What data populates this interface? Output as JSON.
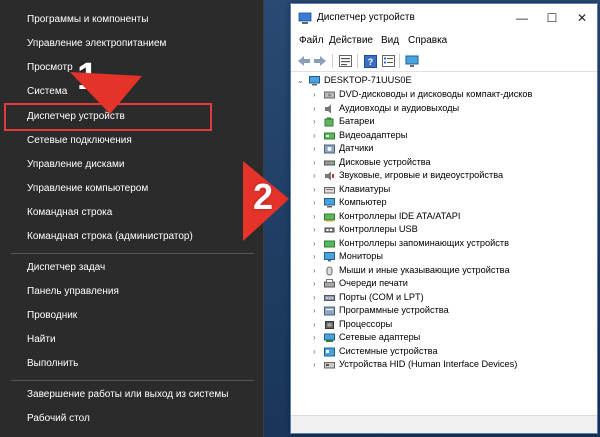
{
  "context_menu": {
    "items": [
      {
        "label": "Программы и компоненты",
        "underline": ""
      },
      {
        "label": "Управление электропитанием",
        "underline": ""
      },
      {
        "label": "Просмотр",
        "underline": ""
      },
      {
        "label": "Система",
        "underline": ""
      },
      {
        "label": "Диспетчер устройств",
        "underline": ""
      },
      {
        "label": "Сетевые подключения",
        "underline": ""
      },
      {
        "label": "Управление дисками",
        "underline": ""
      },
      {
        "label": "Управление компьютером",
        "underline": ""
      },
      {
        "label": "Командная строка",
        "underline": ""
      },
      {
        "label": "Командная строка (администратор)",
        "underline": ""
      },
      {
        "label": "Диспетчер задач",
        "underline": ""
      },
      {
        "label": "Панель управления",
        "underline": ""
      },
      {
        "label": "Проводник",
        "underline": ""
      },
      {
        "label": "Найти",
        "underline": ""
      },
      {
        "label": "Выполнить",
        "underline": ""
      },
      {
        "label": "Завершение работы или выход из системы",
        "underline": ""
      },
      {
        "label": "Рабочий стол",
        "underline": ""
      }
    ],
    "highlighted_item": "Диспетчер устройств"
  },
  "annotations": {
    "step1": "1",
    "step2": "2",
    "arrow_color": "#e5332a"
  },
  "window": {
    "title": "Диспетчер устройств",
    "controls": {
      "minimize": "—",
      "maximize": "☐",
      "close": "✕"
    },
    "menu": [
      "Файл",
      "Действие",
      "Вид",
      "Справка"
    ],
    "root": "DESKTOP-71UUS0E",
    "devices": [
      {
        "label": "DVD-дисководы и дисководы компакт-дисков",
        "icon": "dvd-drive-icon"
      },
      {
        "label": "Аудиовходы и аудиовыходы",
        "icon": "speaker-icon"
      },
      {
        "label": "Батареи",
        "icon": "battery-icon"
      },
      {
        "label": "Видеоадаптеры",
        "icon": "display-adapter-icon"
      },
      {
        "label": "Датчики",
        "icon": "sensor-icon"
      },
      {
        "label": "Дисковые устройства",
        "icon": "disk-drive-icon"
      },
      {
        "label": "Звуковые, игровые и видеоустройства",
        "icon": "sound-device-icon"
      },
      {
        "label": "Клавиатуры",
        "icon": "keyboard-icon"
      },
      {
        "label": "Компьютер",
        "icon": "computer-icon"
      },
      {
        "label": "Контроллеры IDE ATA/ATAPI",
        "icon": "ide-controller-icon"
      },
      {
        "label": "Контроллеры USB",
        "icon": "usb-controller-icon"
      },
      {
        "label": "Контроллеры запоминающих устройств",
        "icon": "storage-controller-icon"
      },
      {
        "label": "Мониторы",
        "icon": "monitor-icon"
      },
      {
        "label": "Мыши и иные указывающие устройства",
        "icon": "mouse-icon"
      },
      {
        "label": "Очереди печати",
        "icon": "printer-icon"
      },
      {
        "label": "Порты (COM и LPT)",
        "icon": "port-icon"
      },
      {
        "label": "Программные устройства",
        "icon": "software-device-icon"
      },
      {
        "label": "Процессоры",
        "icon": "processor-icon"
      },
      {
        "label": "Сетевые адаптеры",
        "icon": "network-adapter-icon"
      },
      {
        "label": "Системные устройства",
        "icon": "system-device-icon"
      },
      {
        "label": "Устройства HID (Human Interface Devices)",
        "icon": "hid-device-icon"
      }
    ]
  }
}
